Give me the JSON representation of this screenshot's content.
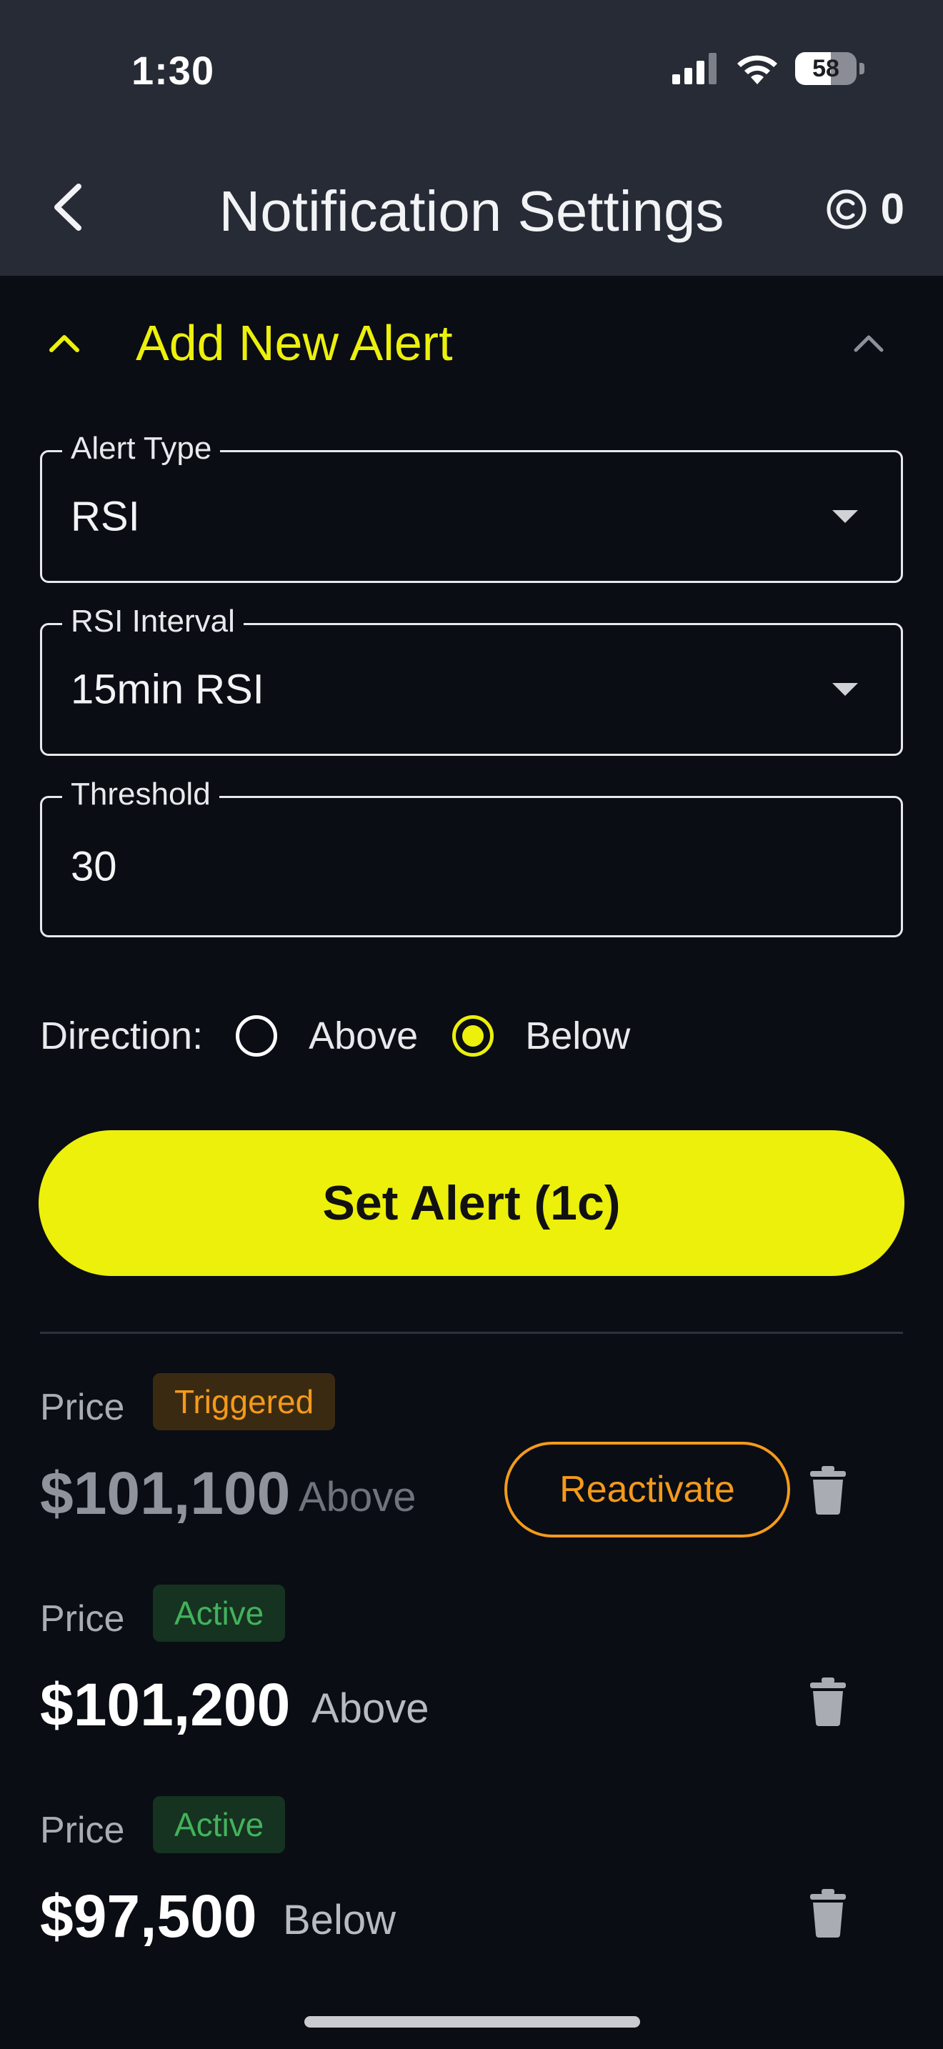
{
  "status_bar": {
    "time": "1:30",
    "battery": "58"
  },
  "header": {
    "title": "Notification Settings",
    "credits": "0"
  },
  "section": {
    "title": "Add New Alert"
  },
  "form": {
    "alert_type": {
      "label": "Alert Type",
      "value": "RSI"
    },
    "rsi_interval": {
      "label": "RSI Interval",
      "value": "15min RSI"
    },
    "threshold": {
      "label": "Threshold",
      "value": "30"
    },
    "direction": {
      "label": "Direction:",
      "options": [
        "Above",
        "Below"
      ],
      "selected": "Below"
    },
    "submit_label": "Set Alert (1c)"
  },
  "alerts": [
    {
      "type": "Price",
      "status": "Triggered",
      "price": "$101,100",
      "direction": "Above",
      "action": "Reactivate"
    },
    {
      "type": "Price",
      "status": "Active",
      "price": "$101,200",
      "direction": "Above"
    },
    {
      "type": "Price",
      "status": "Active",
      "price": "$97,500",
      "direction": "Below"
    }
  ],
  "colors": {
    "accent": "#ecf00b",
    "header_bg": "#272b36",
    "page_bg": "#0a0d14",
    "triggered": "#f49a1a",
    "active": "#43b25c"
  },
  "icons": {
    "back": "chevron-left-icon",
    "credits": "copyright-icon",
    "collapse": "chevron-up-icon",
    "delete": "trash-icon"
  }
}
